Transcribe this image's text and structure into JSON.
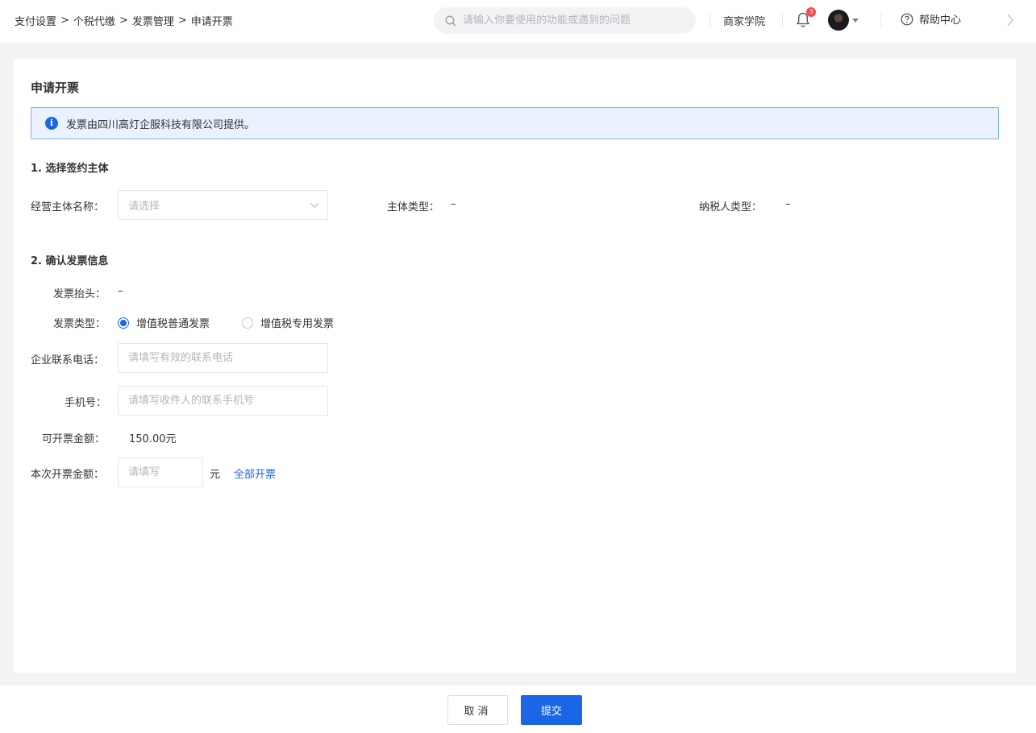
{
  "header": {
    "breadcrumb": [
      "支付设置",
      "个税代缴",
      "发票管理",
      "申请开票"
    ],
    "breadcrumb_separator": ">",
    "search_placeholder": "请输入你要使用的功能或遇到的问题",
    "academy_label": "商家学院",
    "notification_count": "3",
    "help_label": "帮助中心"
  },
  "card": {
    "title": "申请开票",
    "notice": "发票由四川高灯企服科技有限公司提供。",
    "section1": {
      "title": "1. 选择签约主体",
      "entity_name_label": "经营主体名称：",
      "entity_name_placeholder": "请选择",
      "entity_type_label": "主体类型：",
      "entity_type_value": "–",
      "taxpayer_type_label": "纳税人类型：",
      "taxpayer_type_value": "–"
    },
    "section2": {
      "title": "2. 确认发票信息",
      "invoice_header_label": "发票抬头：",
      "invoice_header_value": "–",
      "invoice_type_label": "发票类型：",
      "invoice_type_options": [
        "增值税普通发票",
        "增值税专用发票"
      ],
      "invoice_type_selected": "增值税普通发票",
      "company_phone_label": "企业联系电话：",
      "company_phone_placeholder": "请填写有效的联系电话",
      "mobile_label": "手机号：",
      "mobile_placeholder": "请填写收件人的联系手机号",
      "available_amount_label": "可开票金额：",
      "available_amount_value": "150.00元",
      "this_amount_label": "本次开票金额：",
      "this_amount_placeholder": "请填写",
      "amount_unit": "元",
      "invoice_all_link": "全部开票"
    }
  },
  "footer": {
    "cancel_label": "取消",
    "submit_label": "提交"
  },
  "colors": {
    "primary": "#1a66e6",
    "notice_bg": "#eaf2ff",
    "notice_border": "#86aee8",
    "badge": "#f44a4a",
    "page_bg": "#f2f3f5"
  }
}
